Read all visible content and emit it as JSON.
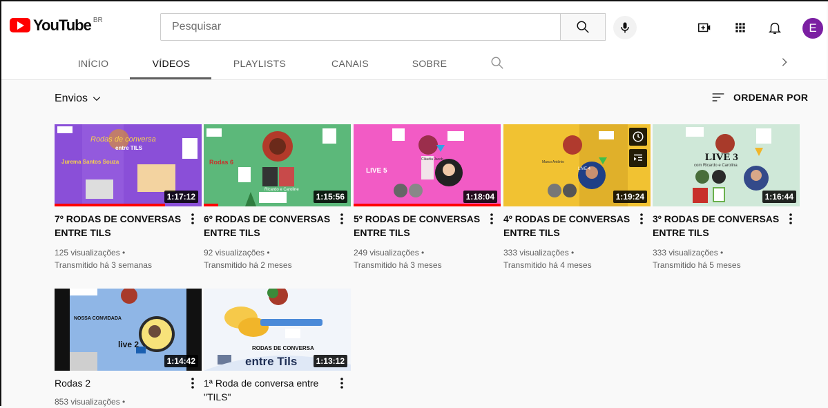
{
  "header": {
    "logo_text": "YouTube",
    "country_code": "BR",
    "search_placeholder": "Pesquisar",
    "avatar_letter": "E"
  },
  "tabs": [
    {
      "label": "INÍCIO",
      "active": false
    },
    {
      "label": "VÍDEOS",
      "active": true
    },
    {
      "label": "PLAYLISTS",
      "active": false
    },
    {
      "label": "CANAIS",
      "active": false
    },
    {
      "label": "SOBRE",
      "active": false
    }
  ],
  "filter": {
    "uploads_label": "Envios",
    "sort_label": "ORDENAR POR"
  },
  "videos": [
    {
      "title": "7º RODAS DE CONVERSAS ENTRE TILS",
      "duration": "1:17:12",
      "views": "125 visualizações •",
      "time": "Transmitido há 3 semanas",
      "progress": 0.75,
      "thumb": {
        "bg": "#8a4fd8",
        "heading": "Rodas de conversa",
        "sub": "entre TILS",
        "guest": "Jurema Santos Souza"
      }
    },
    {
      "title": "6º RODAS DE CONVERSAS ENTRE TILS",
      "duration": "1:15:56",
      "views": "92 visualizações •",
      "time": "Transmitido há 2 meses",
      "progress": 0.1,
      "thumb": {
        "bg": "#5cb87a",
        "heading": "Rodas 6",
        "sub": "Ricardo e Caroline"
      }
    },
    {
      "title": "5º RODAS DE CONVERSAS ENTRE TILS",
      "duration": "1:18:04",
      "views": "249 visualizações •",
      "time": "Transmitido há 3 meses",
      "progress": 1.0,
      "thumb": {
        "bg": "#f25bc5",
        "heading": "LIVE 5",
        "sub": "Cláudia Jacob"
      }
    },
    {
      "title": "4º RODAS DE CONVERSAS ENTRE TILS",
      "duration": "1:19:24",
      "views": "333 visualizações •",
      "time": "Transmitido há 4 meses",
      "progress": 0,
      "thumb": {
        "bg": "#f1c232",
        "heading": "LIVE 4",
        "sub": "Marco Antônio"
      }
    },
    {
      "title": "3º RODAS DE CONVERSAS ENTRE TILS",
      "duration": "1:16:44",
      "views": "333 visualizações •",
      "time": "Transmitido há 5 meses",
      "progress": 0,
      "thumb": {
        "bg": "#cfe8d8",
        "heading": "LIVE 3",
        "sub": "com Ricardo e Carolina"
      }
    },
    {
      "title": "Rodas 2",
      "duration": "1:14:42",
      "views": "853 visualizações •",
      "time": "",
      "progress": 0,
      "thumb": {
        "bg": "#8fb6e6",
        "heading": "NOSSA CONVIDADA",
        "sub": "live 2"
      }
    },
    {
      "title": "1ª Roda de conversa entre \"TILS\"",
      "duration": "1:13:12",
      "views": "",
      "time": "",
      "progress": 0,
      "thumb": {
        "bg": "#f2f5fa",
        "heading": "RODAS DE CONVERSA",
        "sub": "entre Tils"
      }
    }
  ],
  "colors": {
    "brand_red": "#ff0000",
    "avatar": "#7b1fa2"
  }
}
